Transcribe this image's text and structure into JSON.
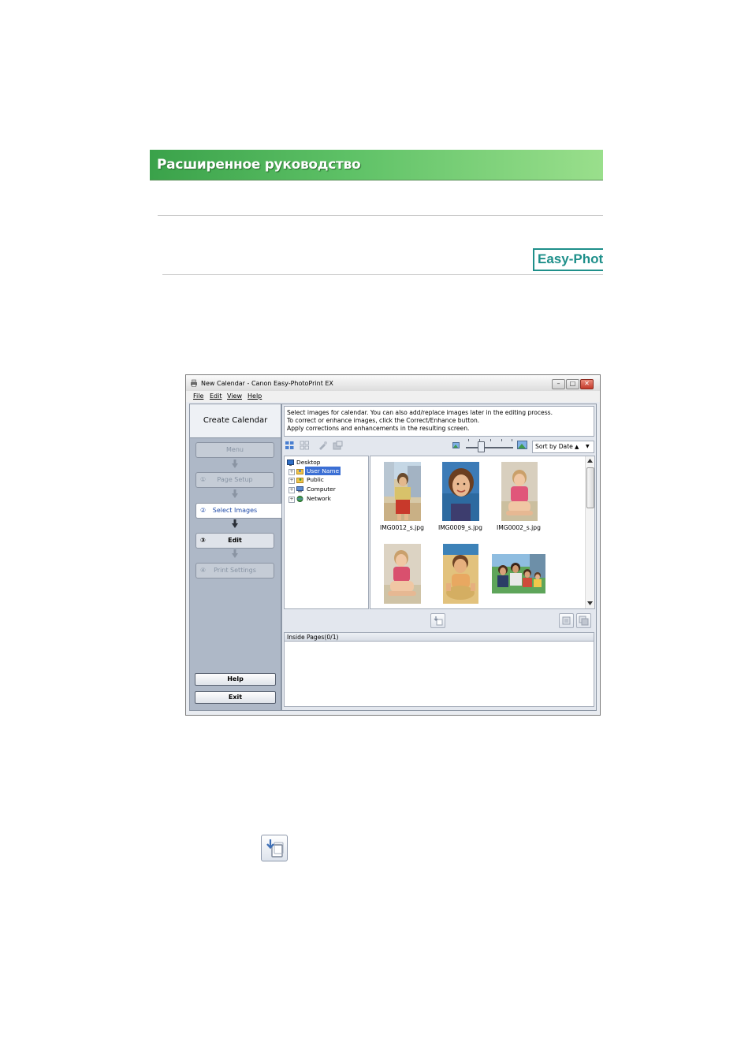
{
  "header": {
    "title": "Расширенное руководство",
    "logo_text": "Easy-PhotoPrint EX"
  },
  "window": {
    "title": "New Calendar - Canon Easy-PhotoPrint EX",
    "controls": {
      "minimize": "–",
      "maximize": "□",
      "close": "✕"
    },
    "menu": [
      "File",
      "Edit",
      "View",
      "Help"
    ]
  },
  "left_panel": {
    "heading": "Create Calendar",
    "menu_button": "Menu",
    "steps": [
      {
        "num": "①",
        "label": "Page Setup"
      },
      {
        "num": "②",
        "label": "Select Images"
      },
      {
        "num": "③",
        "label": "Edit"
      },
      {
        "num": "④",
        "label": "Print Settings"
      }
    ],
    "help_button": "Help",
    "exit_button": "Exit"
  },
  "instructions": [
    "Select images for calendar. You can also add/replace images later in the editing process.",
    "To correct or enhance images, click the Correct/Enhance button.",
    "Apply corrections and enhancements in the resulting screen."
  ],
  "toolbar": {
    "sort": "Sort by Date",
    "sort_arrow": "▲",
    "dropdown_arrow": "▼"
  },
  "tree": [
    {
      "label": "Desktop"
    },
    {
      "label": "User Name",
      "selected": true
    },
    {
      "label": "Public"
    },
    {
      "label": "Computer"
    },
    {
      "label": "Network"
    }
  ],
  "thumbnails": [
    {
      "file": "IMG0012_s.jpg"
    },
    {
      "file": "IMG0009_s.jpg"
    },
    {
      "file": "IMG0002_s.jpg"
    }
  ],
  "inside_pages": {
    "label": "Inside Pages(0/1)"
  },
  "colors": {
    "banner": "#4cb357",
    "accent_teal": "#1e8f8a",
    "selection": "#3b6fd4"
  }
}
